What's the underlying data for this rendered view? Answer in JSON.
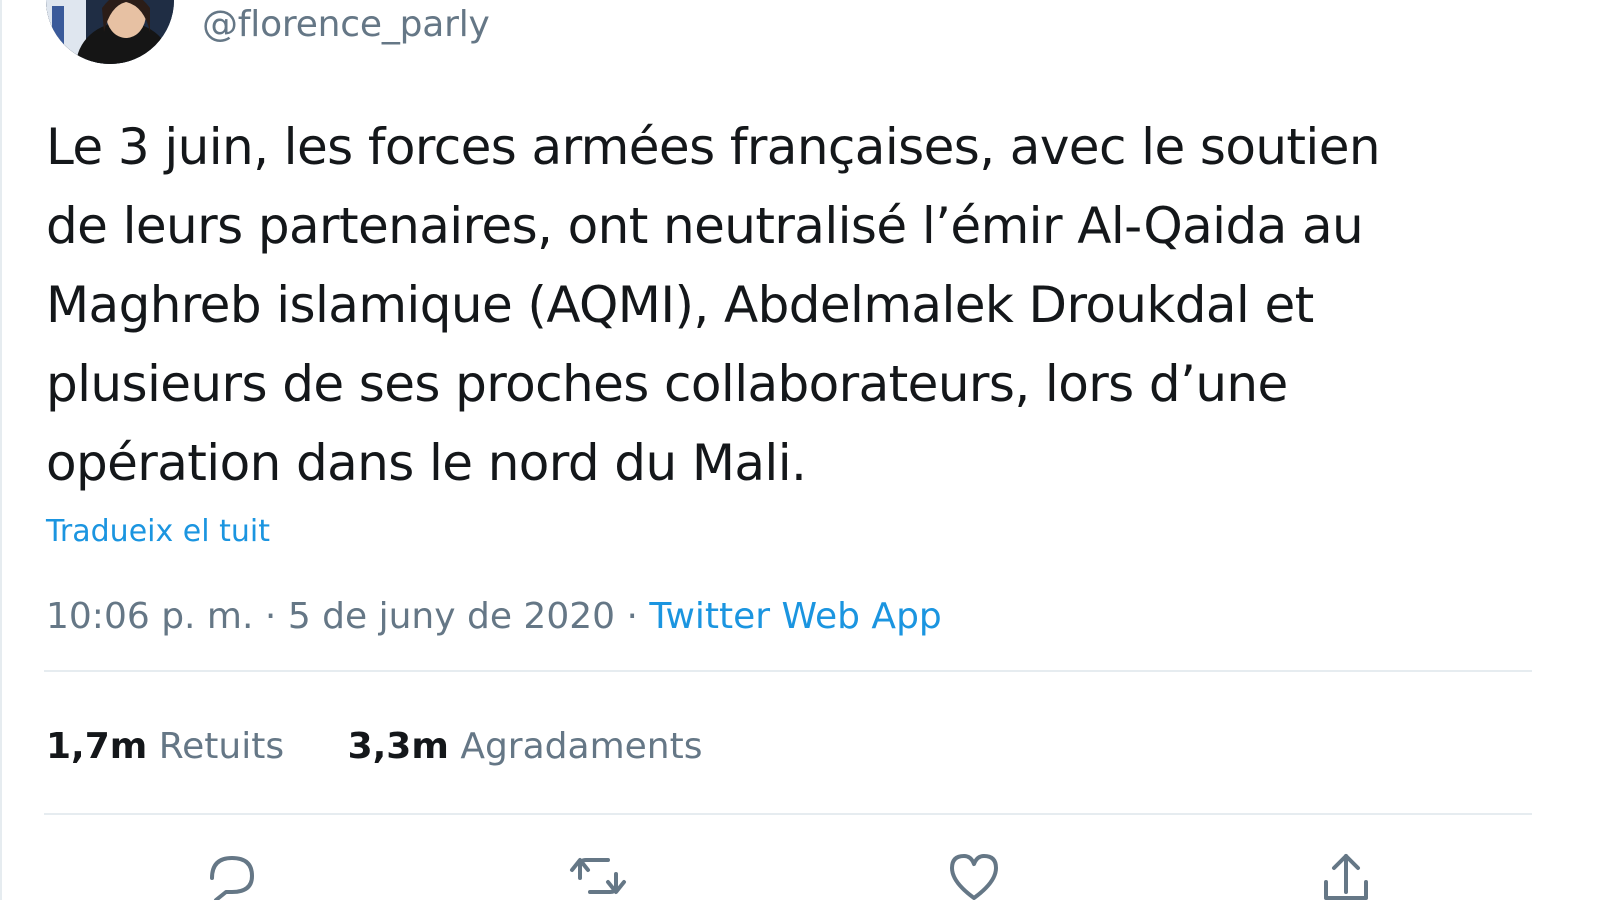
{
  "author": {
    "handle": "@florence_parly"
  },
  "tweet": {
    "text": "Le 3 juin, les forces armées françaises, avec le soutien\nde leurs partenaires, ont neutralisé l’émir Al-Qaida au\nMaghreb islamique (AQMI), Abdelmalek Droukdal et\nplusieurs de ses proches collaborateurs, lors d’une\nopération dans le nord du Mali.",
    "translate_label": "Tradueix el tuit",
    "time": "10:06 p. m.",
    "separator": "·",
    "date": "5 de juny de 2020",
    "source": "Twitter Web App"
  },
  "stats": {
    "retweets_count": "1,7m",
    "retweets_label": "Retuits",
    "likes_count": "3,3m",
    "likes_label": "Agradaments"
  },
  "actions": [
    {
      "icon": "reply-icon"
    },
    {
      "icon": "retweet-icon"
    },
    {
      "icon": "like-icon"
    },
    {
      "icon": "share-icon"
    }
  ],
  "colors": {
    "link": "#1b95e0",
    "secondary_text": "#657786",
    "primary_text": "#14171a",
    "divider": "#e6ecf0"
  }
}
